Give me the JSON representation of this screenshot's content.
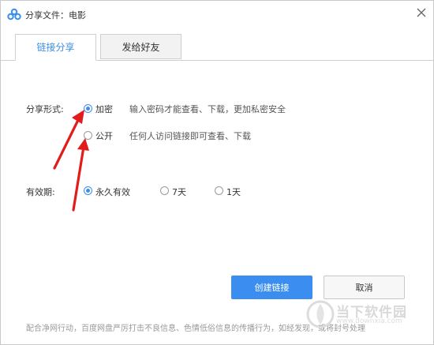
{
  "window": {
    "title": "分享文件：电影",
    "icon": "baidu-cloud-icon",
    "close_icon": "close-icon"
  },
  "tabs": [
    {
      "label": "链接分享",
      "active": true
    },
    {
      "label": "发给好友",
      "active": false
    }
  ],
  "share_form": {
    "label": "分享形式:",
    "options": [
      {
        "label": "加密",
        "desc": "输入密码才能查看、下载，更加私密安全",
        "checked": true
      },
      {
        "label": "公开",
        "desc": "任何人访问链接即可查看、下载",
        "checked": false
      }
    ]
  },
  "validity": {
    "label": "有效期:",
    "options": [
      {
        "label": "永久有效",
        "checked": true
      },
      {
        "label": "7天",
        "checked": false
      },
      {
        "label": "1天",
        "checked": false
      }
    ]
  },
  "buttons": {
    "create": "创建链接",
    "cancel": "取消"
  },
  "notice": "配合净网行动，百度网盘严厉打击不良信息、色情低俗信息的传播行为，如经发现，或将封号处理",
  "watermark": {
    "text": "当下软件园",
    "sub": "www.downxia.com"
  },
  "colors": {
    "accent": "#3b8ef0",
    "annotation_arrow": "#e21b1b"
  }
}
